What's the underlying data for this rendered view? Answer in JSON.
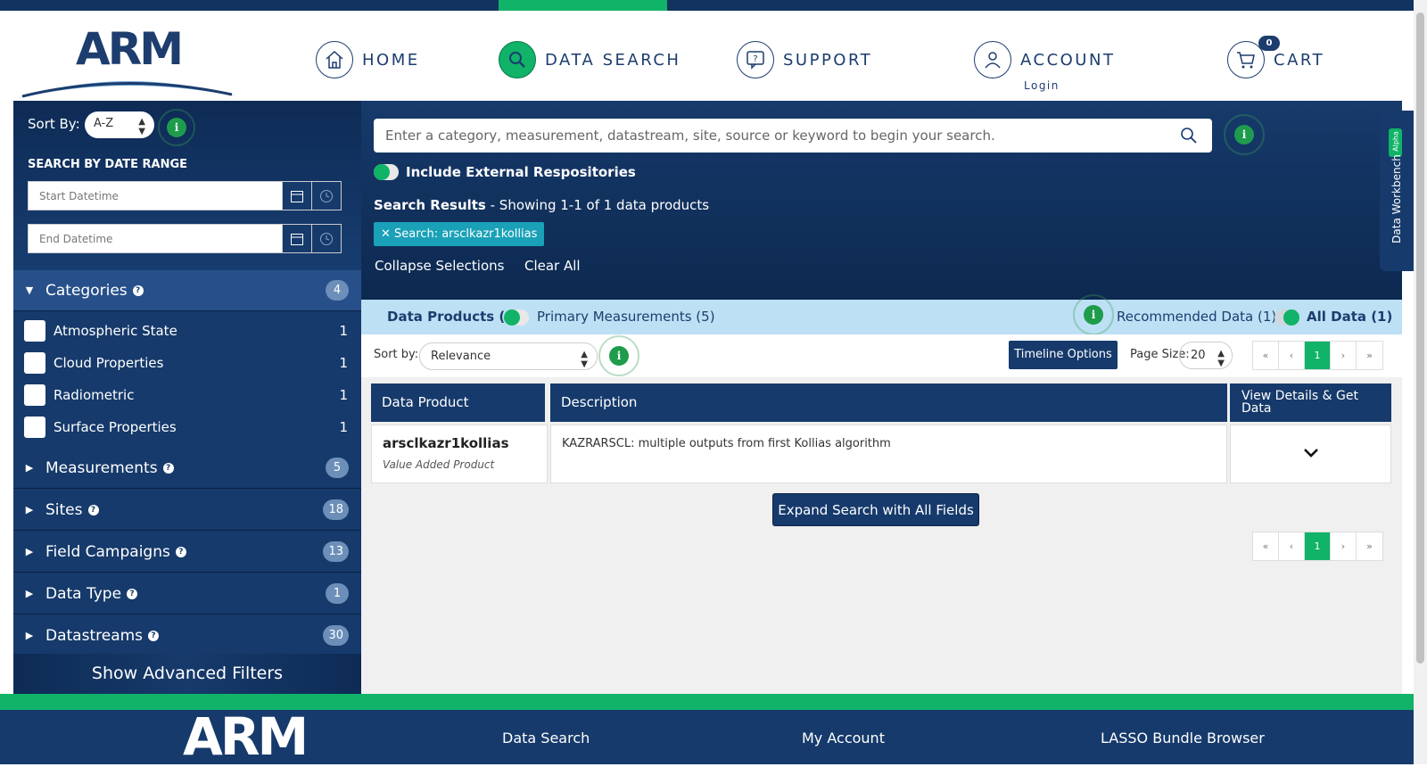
{
  "nav": {
    "home": "HOME",
    "data_search": "DATA SEARCH",
    "support": "SUPPORT",
    "account": "ACCOUNT",
    "account_sub": "Login",
    "cart": "CART",
    "cart_count": "0"
  },
  "logo_text": "ARM",
  "sidebar": {
    "sort_label": "Sort By:",
    "sort_value": "A-Z",
    "date_range_title": "SEARCH BY DATE RANGE",
    "start_placeholder": "Start Datetime",
    "end_placeholder": "End Datetime",
    "categories": {
      "label": "Categories",
      "count": "4",
      "items": [
        {
          "label": "Atmospheric State",
          "count": "1"
        },
        {
          "label": "Cloud Properties",
          "count": "1"
        },
        {
          "label": "Radiometric",
          "count": "1"
        },
        {
          "label": "Surface Properties",
          "count": "1"
        }
      ]
    },
    "facets": [
      {
        "label": "Measurements",
        "count": "5"
      },
      {
        "label": "Sites",
        "count": "18"
      },
      {
        "label": "Field Campaigns",
        "count": "13"
      },
      {
        "label": "Data Type",
        "count": "1"
      },
      {
        "label": "Datastreams",
        "count": "30"
      }
    ],
    "advanced": "Show Advanced Filters"
  },
  "search": {
    "placeholder": "Enter a category, measurement, datastream, site, source or keyword to begin your search.",
    "external": "Include External Respositories",
    "results_bold": "Search Results",
    "results_rest": " - Showing 1-1 of 1 data products",
    "chip": "Search: arsclkazr1kollias",
    "collapse": "Collapse Selections",
    "clear": "Clear All"
  },
  "tabs": {
    "data_products": "Data Products (1)",
    "primary": "Primary Measurements (5)",
    "recommended": "Recommended Data (1)",
    "all": "All Data (1)"
  },
  "sortrow": {
    "label": "Sort by:",
    "value": "Relevance",
    "timeline": "Timeline Options",
    "page_size_label": "Page Size:",
    "page_size": "20",
    "pager": [
      "«",
      "‹",
      "1",
      "›",
      "»"
    ]
  },
  "table": {
    "headers": [
      "Data Product",
      "Description",
      "View Details & Get Data"
    ],
    "rows": [
      {
        "name": "arsclkazr1kollias",
        "type": "Value Added Product",
        "description": "KAZRARSCL: multiple outputs from first Kollias algorithm"
      }
    ]
  },
  "expand_button": "Expand Search with All Fields",
  "workbench": {
    "label": "Data Workbench",
    "badge": "Alpha"
  },
  "footer": {
    "logo": "ARM",
    "links": [
      "Data Search",
      "My Account",
      "LASSO Bundle Browser"
    ]
  },
  "colors": {
    "navy": "#163a6b",
    "green": "#10b368",
    "lightblue": "#bde0f5",
    "teal": "#1aa1b8"
  }
}
